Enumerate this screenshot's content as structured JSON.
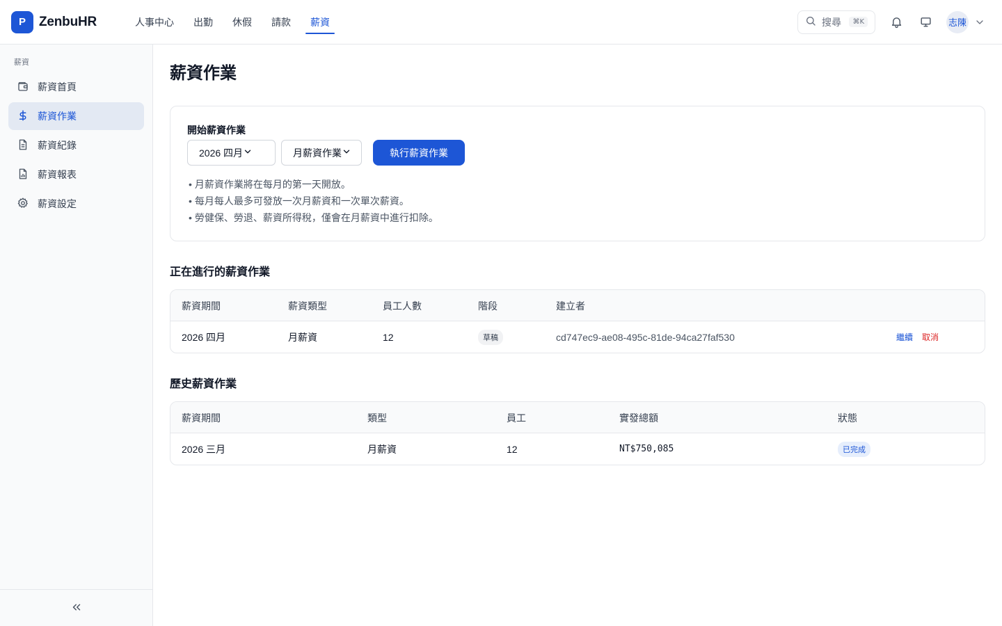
{
  "brand": {
    "logo_letter": "P",
    "name": "ZenbuHR"
  },
  "topnav": [
    {
      "label": "人事中心",
      "active": false
    },
    {
      "label": "出勤",
      "active": false
    },
    {
      "label": "休假",
      "active": false
    },
    {
      "label": "請款",
      "active": false
    },
    {
      "label": "薪資",
      "active": true
    }
  ],
  "search": {
    "label": "搜尋",
    "shortcut": "⌘K"
  },
  "user": {
    "avatar_text": "志陳"
  },
  "sidebar": {
    "section": "薪資",
    "items": [
      {
        "label": "薪資首頁",
        "icon": "wallet-icon",
        "active": false
      },
      {
        "label": "薪資作業",
        "icon": "dollar-icon",
        "active": true
      },
      {
        "label": "薪資紀錄",
        "icon": "document-icon",
        "active": false
      },
      {
        "label": "薪資報表",
        "icon": "report-icon",
        "active": false
      },
      {
        "label": "薪資設定",
        "icon": "gear-icon",
        "active": false
      }
    ]
  },
  "page": {
    "title": "薪資作業"
  },
  "start_card": {
    "label": "開始薪資作業",
    "period_value": "2026 四月",
    "type_value": "月薪資作業",
    "run_button": "執行薪資作業",
    "notes": [
      "月薪資作業將在每月的第一天開放。",
      "每月每人最多可發放一次月薪資和一次單次薪資。",
      "勞健保、勞退、薪資所得稅，僅會在月薪資中進行扣除。"
    ]
  },
  "active_runs": {
    "title": "正在進行的薪資作業",
    "headers": [
      "薪資期間",
      "薪資類型",
      "員工人數",
      "階段",
      "建立者"
    ],
    "rows": [
      {
        "period": "2026 四月",
        "type": "月薪資",
        "employees": "12",
        "stage": "草稿",
        "creator": "cd747ec9-ae08-495c-81de-94ca27faf530",
        "continue_label": "繼續",
        "cancel_label": "取消"
      }
    ]
  },
  "history_runs": {
    "title": "歷史薪資作業",
    "headers": [
      "薪資期間",
      "類型",
      "員工",
      "實發總額",
      "狀態"
    ],
    "rows": [
      {
        "period": "2026 三月",
        "type": "月薪資",
        "employees": "12",
        "net_total": "NT$750,085",
        "status": "已完成"
      }
    ]
  },
  "colors": {
    "accent": "#1d56d6",
    "danger": "#dc2626",
    "sidebar_active_bg": "#e3e9f3"
  }
}
